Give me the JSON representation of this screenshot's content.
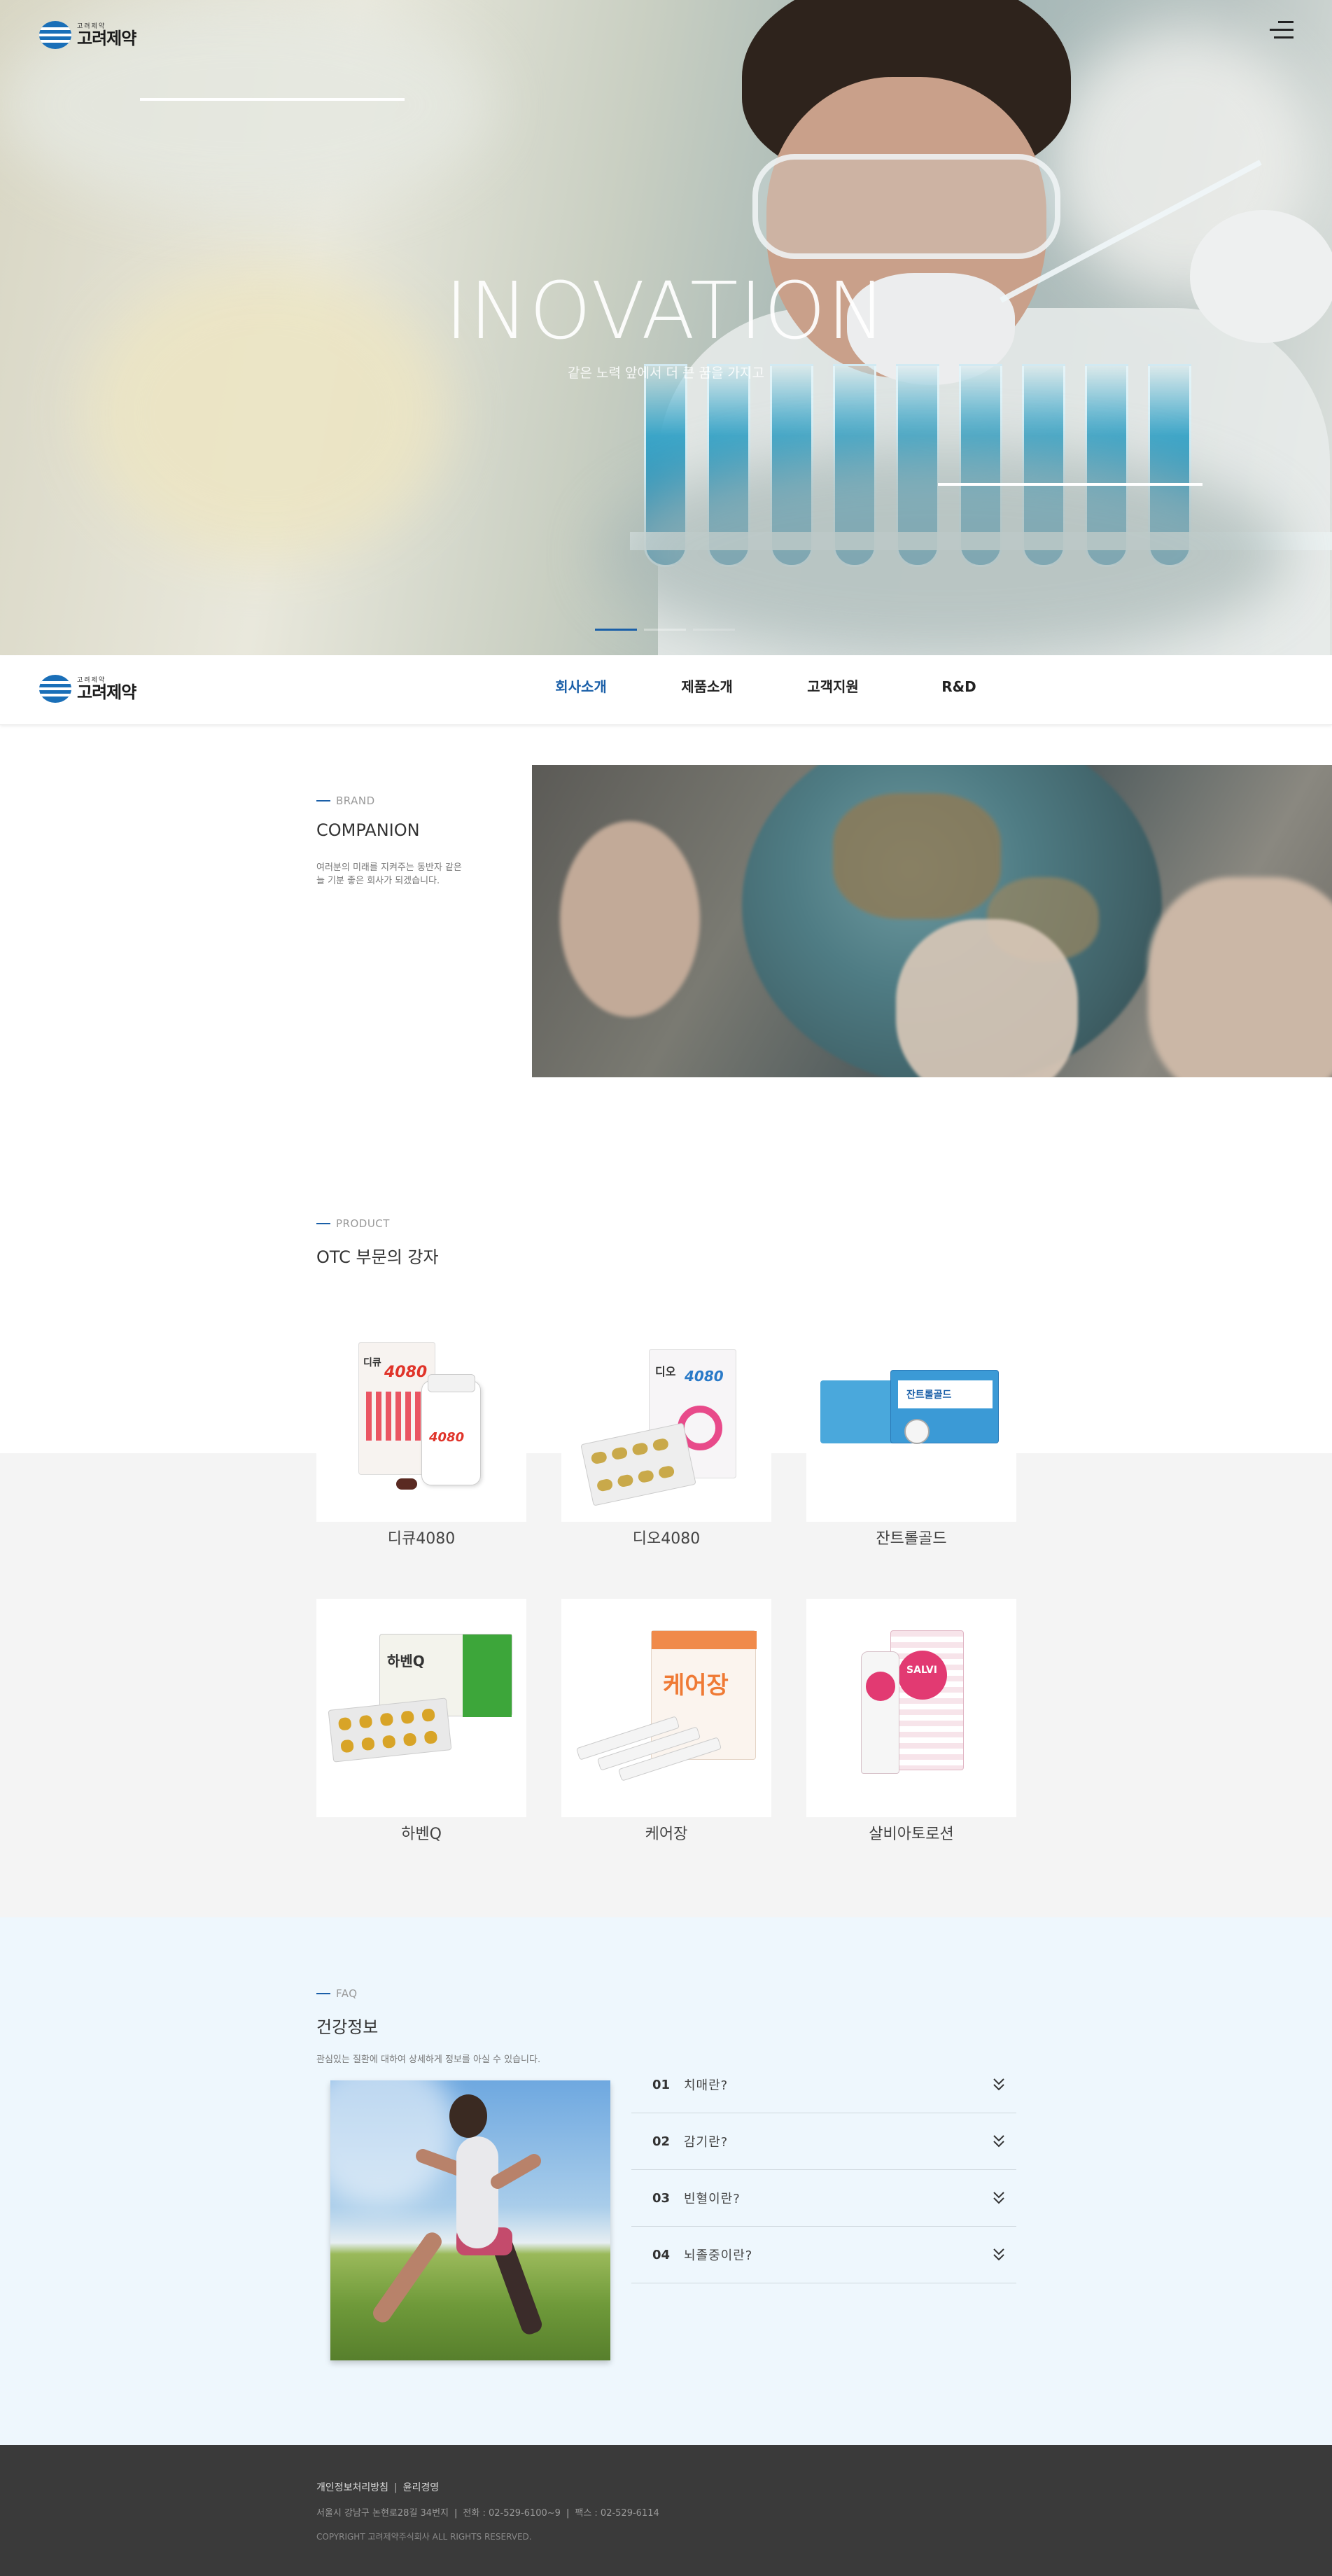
{
  "brand": {
    "logo_small": "고려제약",
    "logo_big": "고려제약"
  },
  "hero": {
    "title": "INOVATION",
    "subtitle": "같은 노력 앞에서 더 큰 꿈을 가지고",
    "slides_total": 1,
    "active_slide": 1
  },
  "nav": {
    "items": [
      {
        "label": "회사소개",
        "active": true
      },
      {
        "label": "제품소개",
        "active": false
      },
      {
        "label": "고객지원",
        "active": false
      },
      {
        "label": "R&D",
        "active": false
      }
    ]
  },
  "brand_section": {
    "label": "BRAND",
    "title": "COMPANION",
    "desc_line1": "여러분의 미래를 지켜주는 동반자 같은",
    "desc_line2": "늘 기분 좋은 회사가 되겠습니다."
  },
  "product_section": {
    "label": "PRODUCT",
    "title": "OTC 부문의 강자",
    "products": [
      {
        "name": "디큐4080"
      },
      {
        "name": "디오4080"
      },
      {
        "name": "잔트롤골드"
      },
      {
        "name": "하벤Q"
      },
      {
        "name": "케어장"
      },
      {
        "name": "살비아토로션"
      }
    ],
    "box_labels": {
      "dq": "디큐",
      "dq_num": "4080",
      "dio": "디오",
      "dio_num": "4080",
      "zan": "잔트롤골드",
      "haven": "하벤Q",
      "care": "케어장",
      "salvi": "SALVI"
    }
  },
  "faq_section": {
    "label": "FAQ",
    "title": "건강정보",
    "desc": "관심있는 질환에 대하여 상세하게 정보를 아실 수 있습니다.",
    "items": [
      {
        "num": "01",
        "question": "치매란?"
      },
      {
        "num": "02",
        "question": "감기란?"
      },
      {
        "num": "03",
        "question": "빈혈이란?"
      },
      {
        "num": "04",
        "question": "뇌졸중이란?"
      }
    ]
  },
  "footer": {
    "privacy": "개인정보처리방침",
    "ethics": "윤리경영",
    "address": "서울시 강남구 논현로28길 34번지",
    "phone": "전화 : 02-529-6100~9",
    "fax": "팩스 : 02-529-6114",
    "copyright": "COPYRIGHT 고려제약주식회사 ALL RIGHTS RESERVED."
  },
  "colors": {
    "accent": "#1a5fa8",
    "footer_bg": "#3a3a3a",
    "faq_bg": "#eef7fd",
    "product_bg": "#f4f4f4"
  },
  "icons": [
    "hamburger-menu-icon",
    "chevron-double-down-icon"
  ]
}
